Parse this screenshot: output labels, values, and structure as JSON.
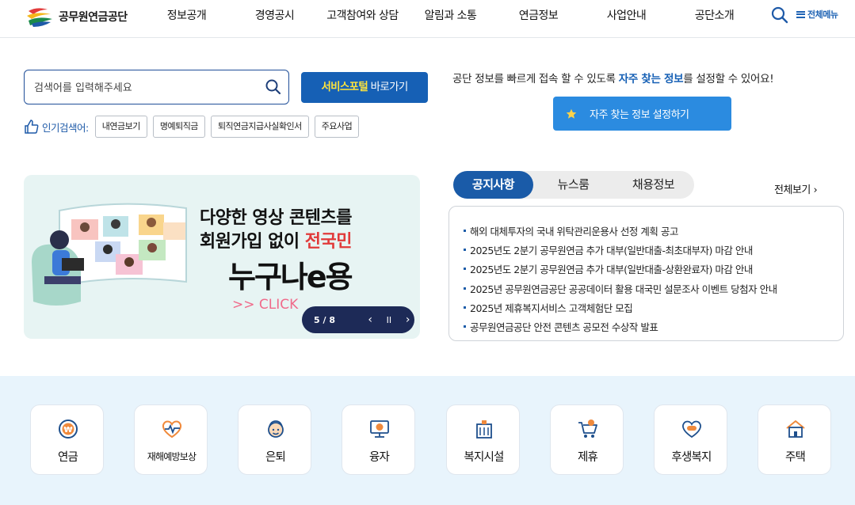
{
  "header": {
    "logo_text": "공무원연금공단",
    "nav": [
      "정보공개",
      "경영공시",
      "고객참여와 상담",
      "알림과 소통",
      "연금정보",
      "사업안내",
      "공단소개"
    ],
    "all_menu": "전체메뉴"
  },
  "search": {
    "placeholder": "검색어를 입력해주세요",
    "portal_highlight": "서비스포털",
    "portal_rest": " 바로가기",
    "popular_label": "인기검색어:",
    "popular_tags": [
      "내연금보기",
      "명예퇴직금",
      "퇴직연금지급사실확인서",
      "주요사업"
    ]
  },
  "favorites": {
    "text_before": "공단 정보를 빠르게 접속 할 수 있도록 ",
    "text_highlight": "자주 찾는 정보",
    "text_after": "를 설정할 수 있어요!",
    "button": "자주 찾는 정보 설정하기"
  },
  "banner": {
    "line1": "다양한 영상 콘텐츠를",
    "line2_before": "회원가입 없이 ",
    "line2_highlight": "전국민",
    "big": "누구나e용",
    "click": ">> CLICK",
    "page": "5 / 8",
    "prev": "‹",
    "pause": "II",
    "next": "›"
  },
  "notice": {
    "tabs": [
      "공지사항",
      "뉴스룸",
      "채용정보"
    ],
    "active_tab": 0,
    "see_all": "전체보기",
    "items": [
      "해외 대체투자의 국내 위탁관리운용사 선정 계획 공고",
      "2025년도 2분기 공무원연금 추가 대부(일반대출-최초대부자) 마감 안내",
      "2025년도 2분기 공무원연금 추가 대부(일반대출-상환완료자) 마감 안내",
      "2025년 공무원연금공단 공공데이터 활용 대국민 설문조사 이벤트 당첨자 안내",
      "2025년 제휴복지서비스 고객체험단 모집",
      "공무원연금공단 안전 콘텐츠 공모전 수상작 발표"
    ]
  },
  "quick_menu": [
    {
      "label": "연금",
      "icon": "won-coin-icon"
    },
    {
      "label": "재해예방보상",
      "icon": "heart-pulse-icon"
    },
    {
      "label": "은퇴",
      "icon": "retiree-face-icon"
    },
    {
      "label": "융자",
      "icon": "monitor-loan-icon"
    },
    {
      "label": "복지시설",
      "icon": "building-icon"
    },
    {
      "label": "제휴",
      "icon": "cart-icon"
    },
    {
      "label": "후생복지",
      "icon": "heart-hands-icon"
    },
    {
      "label": "주택",
      "icon": "house-icon"
    }
  ],
  "colors": {
    "primary": "#1a5ba8",
    "portal_button": "#1660b5",
    "favorite_button": "#2b8be0",
    "highlight_yellow": "#fde33d",
    "banner_red": "#e13a3a",
    "quick_bg": "#e8f4fc",
    "icon_orange": "#f08a3c"
  }
}
